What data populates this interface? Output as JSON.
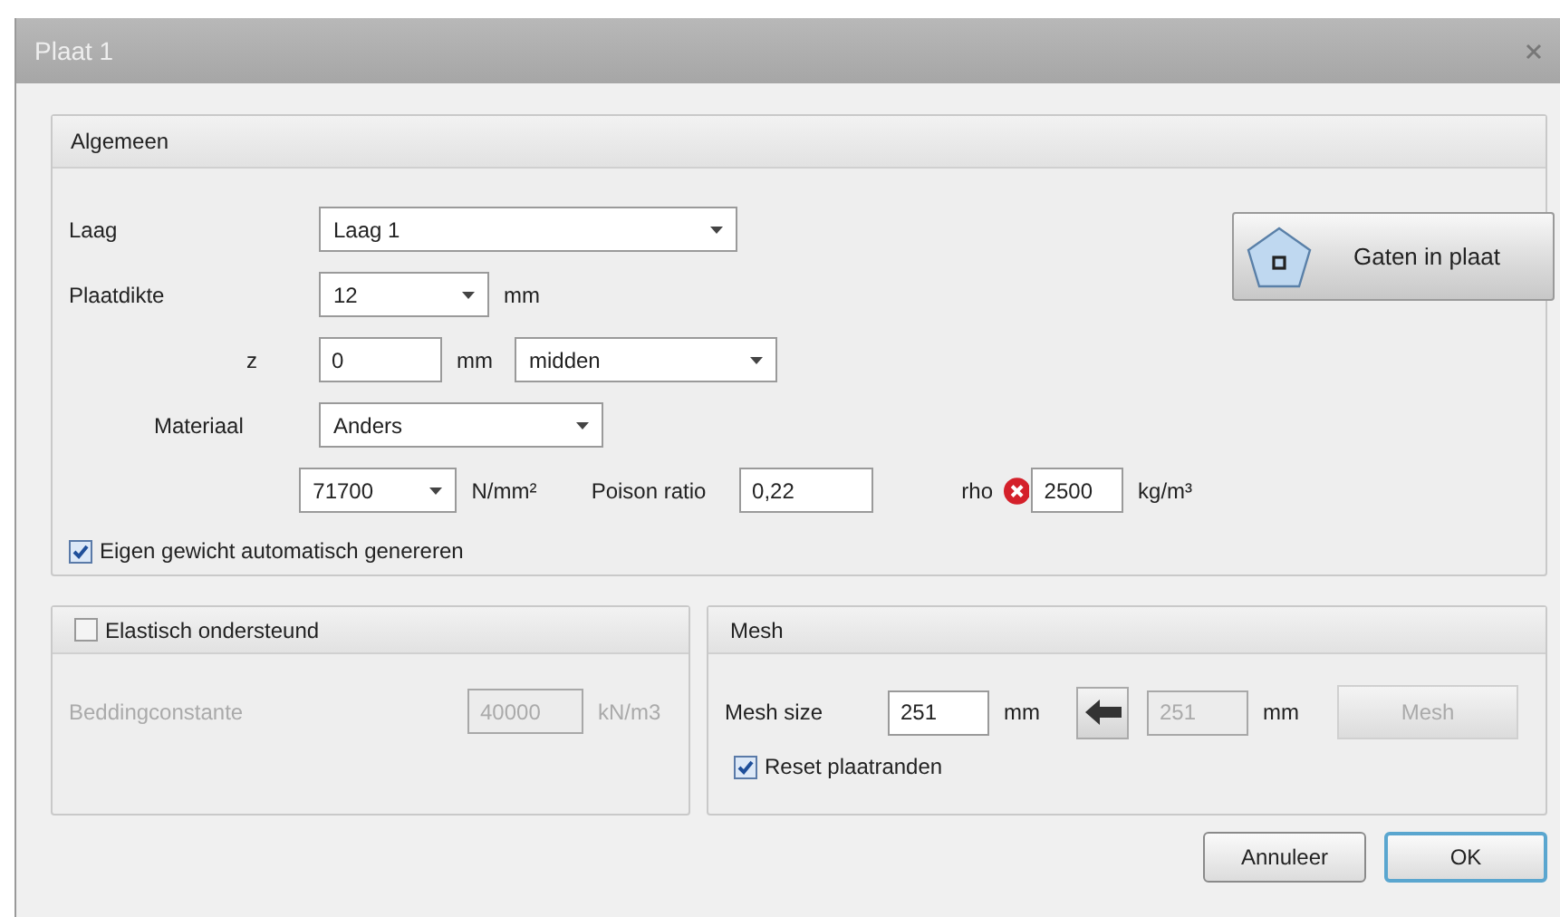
{
  "window": {
    "title": "Plaat 1"
  },
  "general": {
    "title": "Algemeen",
    "layer": {
      "label": "Laag",
      "value": "Laag 1"
    },
    "thickness": {
      "label": "Plaatdikte",
      "value": "12",
      "unit": "mm"
    },
    "z": {
      "label": "z",
      "value": "0",
      "unit": "mm",
      "position": "midden"
    },
    "material": {
      "label": "Materiaal",
      "value": "Anders"
    },
    "modulus": {
      "value": "71700",
      "unit": "N/mm²"
    },
    "poisson": {
      "label": "Poison ratio",
      "value": "0,22"
    },
    "rho": {
      "label": "rho",
      "value": "2500",
      "unit": "kg/m³",
      "error": true
    },
    "self_weight": {
      "label": "Eigen gewicht automatisch genereren",
      "checked": true
    },
    "holes_button": "Gaten in plaat"
  },
  "elastic": {
    "label": "Elastisch ondersteund",
    "checked": false,
    "constant": {
      "label": "Beddingconstante",
      "value": "40000",
      "unit": "kN/m3"
    }
  },
  "mesh": {
    "title": "Mesh",
    "size": {
      "label": "Mesh size",
      "value": "251",
      "unit": "mm"
    },
    "computed": {
      "value": "251",
      "unit": "mm"
    },
    "button": {
      "label": "Mesh",
      "disabled": true
    },
    "reset": {
      "label": "Reset plaatranden",
      "checked": true
    }
  },
  "buttons": [
    {
      "label": "Annuleer",
      "default": false
    },
    {
      "label": "OK",
      "default": true
    }
  ]
}
